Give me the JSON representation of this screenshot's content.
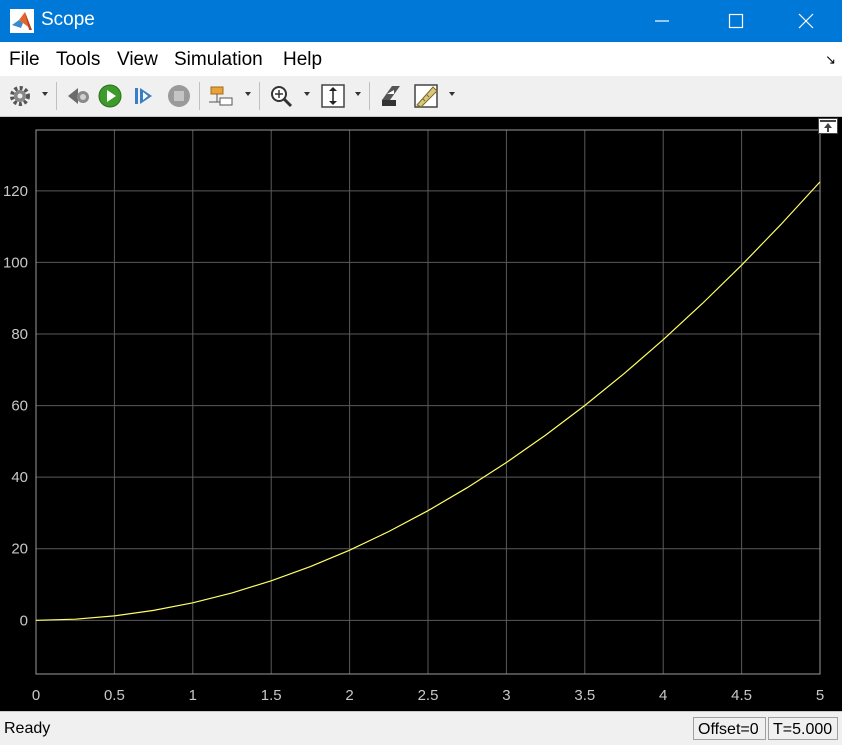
{
  "window": {
    "title": "Scope",
    "title_bar_color": "#0078d7"
  },
  "window_controls": {
    "minimize_icon": "minimize-icon",
    "maximize_icon": "maximize-icon",
    "close_icon": "close-icon"
  },
  "menu": {
    "items": [
      "File",
      "Tools",
      "View",
      "Simulation",
      "Help"
    ],
    "expand_icon": "↘"
  },
  "toolbar": {
    "icons": [
      "gear-icon",
      "step-back-icon",
      "run-icon",
      "step-forward-icon",
      "stop-icon",
      "signal-selector-icon",
      "zoom-icon",
      "scale-axes-icon",
      "highlight-block-icon",
      "measurements-icon"
    ]
  },
  "status": {
    "text": "Ready",
    "offset": "Offset=0",
    "time": "T=5.000"
  },
  "colors": {
    "plot_background": "#000000",
    "grid": "#5a5a5a",
    "frame": "#9a9a9a",
    "tick_text": "#c8c8c8",
    "trace": "#ffff66"
  },
  "chart_data": {
    "type": "line",
    "title": "",
    "xlabel": "",
    "ylabel": "",
    "xlim": [
      0,
      5
    ],
    "ylim": [
      -15,
      137
    ],
    "xticks": [
      0,
      0.5,
      1,
      1.5,
      2,
      2.5,
      3,
      3.5,
      4,
      4.5,
      5
    ],
    "yticks": [
      0,
      20,
      40,
      60,
      80,
      100,
      120
    ],
    "grid": true,
    "series": [
      {
        "color": "#ffff66",
        "x": [
          0,
          0.25,
          0.5,
          0.75,
          1,
          1.25,
          1.5,
          1.75,
          2,
          2.25,
          2.5,
          2.75,
          3,
          3.25,
          3.5,
          3.75,
          4,
          4.25,
          4.5,
          4.75,
          5
        ],
        "y": [
          0,
          0.31,
          1.23,
          2.76,
          4.9,
          7.66,
          11.03,
          15.01,
          19.6,
          24.81,
          30.63,
          37.06,
          44.1,
          51.76,
          60.03,
          68.91,
          78.4,
          88.51,
          99.23,
          110.56,
          122.5
        ]
      }
    ]
  }
}
